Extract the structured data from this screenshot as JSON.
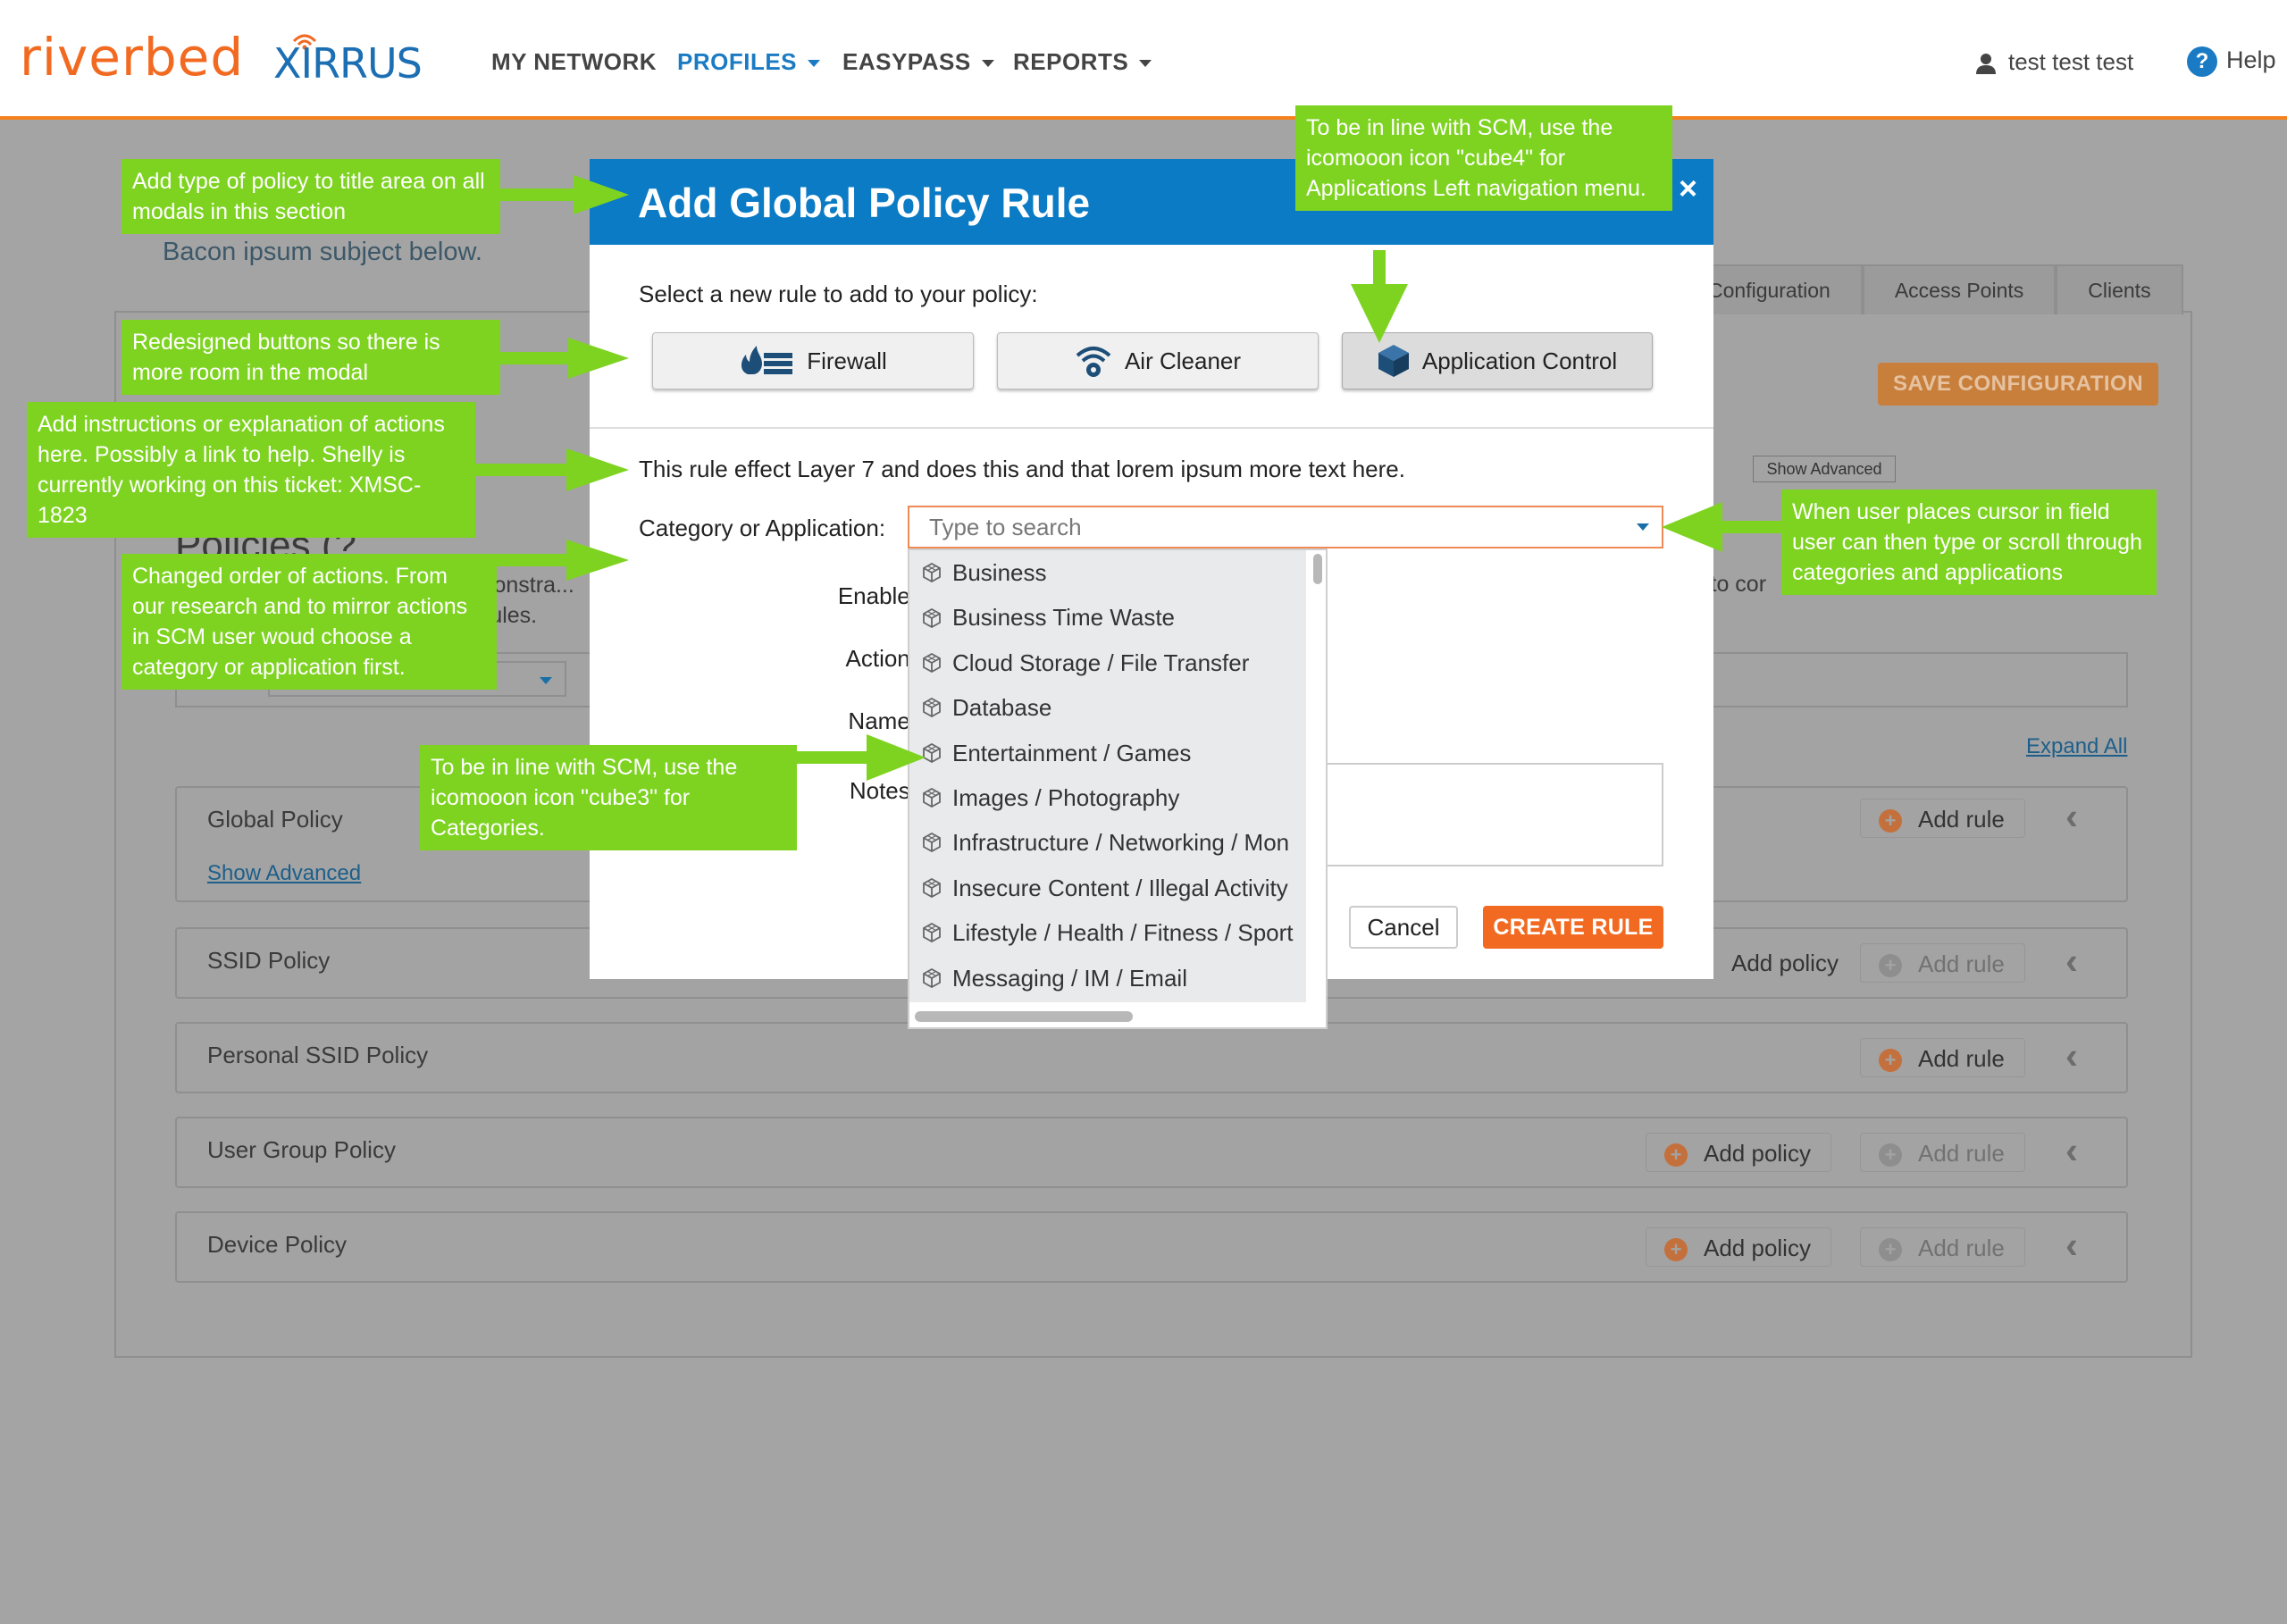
{
  "nav": {
    "logo_riverbed": "riverbed",
    "logo_xirrus": "XIRRUS",
    "items": [
      {
        "label": "MY NETWORK"
      },
      {
        "label": "PROFILES"
      },
      {
        "label": "EASYPASS"
      },
      {
        "label": "REPORTS"
      }
    ],
    "user": "test test test",
    "help": "Help"
  },
  "page": {
    "subtitle": "Bacon ipsum subject below.",
    "tabs": [
      "Configuration",
      "Access Points",
      "Clients"
    ],
    "save_config": "SAVE CONFIGURATION",
    "show_advanced_top": "Show Advanced",
    "policies_title": "Policies (?",
    "policies_desc_line1": "constra...",
    "policies_desc_line2": "rules.",
    "policies_desc_right": "l to cor",
    "expand_all": "Expand All",
    "policies": [
      {
        "name": "Global Policy",
        "show_advanced": "Show Advanced",
        "add_rule": "Add rule"
      },
      {
        "name": "SSID Policy",
        "add_policy": "Add policy",
        "add_rule": "Add rule"
      },
      {
        "name": "Personal SSID Policy",
        "add_rule": "Add rule"
      },
      {
        "name": "User Group Policy",
        "add_policy": "Add policy",
        "add_rule": "Add rule"
      },
      {
        "name": "Device Policy",
        "add_policy": "Add policy",
        "add_rule": "Add rule"
      }
    ]
  },
  "modal": {
    "title": "Add Global Policy Rule",
    "close": "×",
    "intro": "Select a new rule to add to your policy:",
    "rule_buttons": [
      {
        "label": "Firewall",
        "icon": "firewall-icon"
      },
      {
        "label": "Air Cleaner",
        "icon": "air-cleaner-icon"
      },
      {
        "label": "Application Control",
        "icon": "cube4-icon"
      }
    ],
    "instructions": "This rule effect Layer 7 and does this and that lorem ipsum more text here.",
    "labels": {
      "category": "Category or Application:",
      "enable": "Enable:",
      "action": "Action:",
      "name": "Name:",
      "notes": "Notes:"
    },
    "search_placeholder": "Type to search",
    "cancel": "Cancel",
    "create": "CREATE RULE"
  },
  "dropdown": {
    "items": [
      "Business",
      "Business Time Waste",
      "Cloud Storage / File Transfer",
      "Database",
      "Entertainment / Games",
      "Images / Photography",
      "Infrastructure / Networking / Mon",
      "Insecure Content / Illegal Activity",
      "Lifestyle / Health / Fitness / Sport",
      "Messaging / IM / Email"
    ]
  },
  "annotations": {
    "title_area": "Add type of policy to title area on all modals in this section",
    "buttons": "Redesigned buttons so there is more room in the modal",
    "instructions": "Add instructions or explanation of actions here. Possibly a link to help. Shelly is currently working on this ticket: XMSC-1823",
    "order": "Changed order of actions. From our research  and to mirror actions in SCM user woud choose a category or application first.",
    "cube3": "To be in line with SCM, use the icomooon icon \"cube3\" for Categories.",
    "cube4": "To be in line with SCM, use the icomooon icon \"cube4\" for Applications Left navigation menu.",
    "search": "When user places cursor in field user can then type or scroll through categories and applications"
  },
  "colors": {
    "brand_orange": "#f26a21",
    "brand_blue": "#0a7bc4",
    "annotation_green": "#7ed321"
  }
}
